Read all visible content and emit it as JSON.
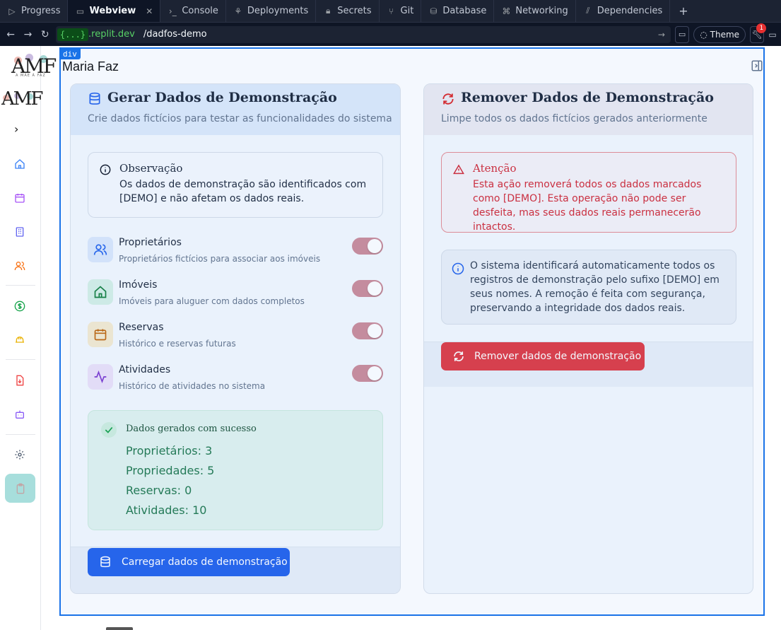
{
  "ide": {
    "tabs": [
      {
        "label": "Progress",
        "icon": "progress-icon"
      },
      {
        "label": "Webview",
        "icon": "monitor-icon",
        "active": true
      },
      {
        "label": "Console",
        "icon": "terminal-icon"
      },
      {
        "label": "Deployments",
        "icon": "deploy-icon"
      },
      {
        "label": "Secrets",
        "icon": "lock-icon"
      },
      {
        "label": "Git",
        "icon": "git-icon"
      },
      {
        "label": "Database",
        "icon": "database-icon"
      },
      {
        "label": "Networking",
        "icon": "network-icon"
      },
      {
        "label": "Dependencies",
        "icon": "package-icon"
      }
    ],
    "add_tab": "+",
    "url_host": "{...}",
    "url_host_rest": ".replit.dev",
    "url_path": "/dadfos-demo",
    "theme_label": "Theme",
    "notifications": "1"
  },
  "inspector_tag": "div",
  "app": {
    "brand": "AMF",
    "brand_tagline": "A MÃE À FAZ",
    "title": "Maria Faz"
  },
  "generate": {
    "title": "Gerar Dados de Demonstração",
    "subtitle": "Crie dados fictícios para testar as funcionalidades do sistema",
    "note_title": "Observação",
    "note_text": "Os dados de demonstração são identificados com [DEMO] e não afetam os dados reais.",
    "options": [
      {
        "title": "Proprietários",
        "desc": "Proprietários fictícios para associar aos imóveis",
        "enabled": true,
        "icon": "users-icon",
        "bg": "#dbe8fb",
        "color": "#2563eb"
      },
      {
        "title": "Imóveis",
        "desc": "Imóveis para aluguer com dados completos",
        "enabled": true,
        "icon": "home-icon",
        "bg": "#d6f1e6",
        "color": "#15803d"
      },
      {
        "title": "Reservas",
        "desc": "Histórico e reservas futuras",
        "enabled": true,
        "icon": "calendar-icon",
        "bg": "#f6ebd0",
        "color": "#c2680c"
      },
      {
        "title": "Atividades",
        "desc": "Histórico de atividades no sistema",
        "enabled": true,
        "icon": "activity-icon",
        "bg": "#ece2f8",
        "color": "#7e3bd0"
      }
    ],
    "success_title": "Dados gerados com sucesso",
    "results": [
      "Proprietários: 3",
      "Propriedades: 5",
      "Reservas: 0",
      "Atividades: 10"
    ],
    "button_label": "Carregar dados de demonstração"
  },
  "remove": {
    "title": "Remover Dados de Demonstração",
    "subtitle": "Limpe todos os dados fictícios gerados anteriormente",
    "alert_title": "Atenção",
    "alert_text": "Esta ação removerá todos os dados marcados como [DEMO]. Esta operação não pode ser desfeita, mas seus dados reais permanecerão intactos.",
    "info_text": "O sistema identificará automaticamente todos os registros de demonstração pelo sufixo [DEMO] em seus nomes. A remoção é feita com segurança, preservando a integridade dos dados reais.",
    "button_label": "Remover dados de demonstração"
  },
  "colors": {
    "primary": "#2563eb",
    "danger": "#e03c45",
    "toggle_on": "#cd8d99",
    "success_text": "#237a4f",
    "sidebar_active": "#a7dedc"
  }
}
